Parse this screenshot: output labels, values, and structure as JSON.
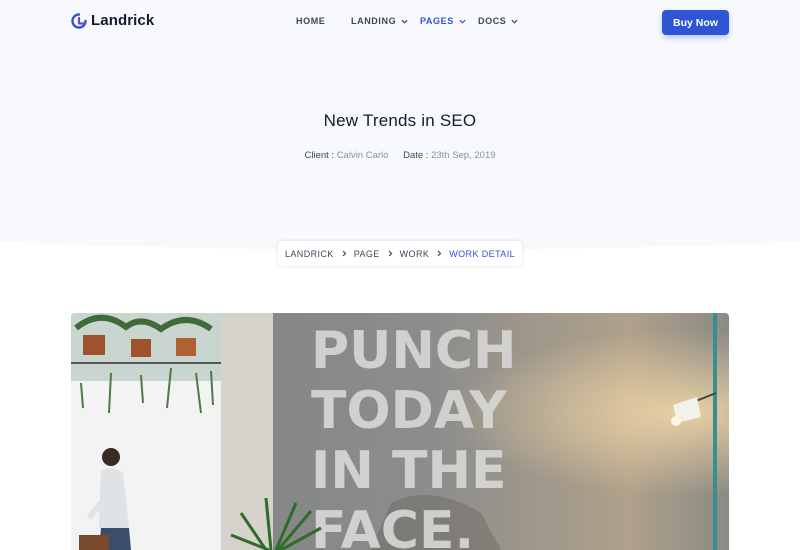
{
  "brand": {
    "name": "Landrick",
    "accent": "#2f55d4"
  },
  "nav": {
    "items": [
      {
        "label": "HOME",
        "has_dropdown": false,
        "active": false
      },
      {
        "label": "LANDING",
        "has_dropdown": true,
        "active": false
      },
      {
        "label": "PAGES",
        "has_dropdown": true,
        "active": true
      },
      {
        "label": "DOCS",
        "has_dropdown": true,
        "active": false
      }
    ],
    "cta_label": "Buy Now"
  },
  "hero": {
    "title": "New Trends in SEO",
    "client_label": "Client :",
    "client_value": "Calvin Carlo",
    "date_label": "Date :",
    "date_value": "23th Sep, 2019"
  },
  "breadcrumb": {
    "items": [
      "LANDRICK",
      "PAGE",
      "WORK",
      "WORK DETAIL"
    ],
    "active_index": 3
  },
  "feature_image": {
    "wall_text": [
      "PUNCH",
      "TODAY",
      "IN THE",
      "FACE."
    ],
    "icons": [
      "plant-icon",
      "lamp-icon",
      "person-icon"
    ]
  }
}
